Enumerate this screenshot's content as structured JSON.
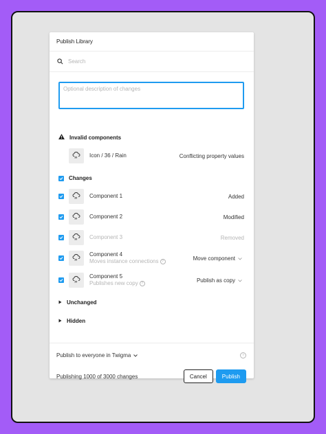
{
  "dialog": {
    "title": "Publish Library",
    "search_placeholder": "Search",
    "description_placeholder": "Optional description of changes"
  },
  "invalid": {
    "heading": "Invalid components",
    "item_name": "Icon / 36 / Rain",
    "item_status": "Conflicting property values"
  },
  "changes": {
    "heading": "Changes",
    "items": [
      {
        "name": "Component 1",
        "status": "Added"
      },
      {
        "name": "Component 2",
        "status": "Modified"
      },
      {
        "name": "Component 3",
        "status": "Removed"
      },
      {
        "name": "Component 4",
        "subtitle": "Moves instance connections",
        "action": "Move component"
      },
      {
        "name": "Component 5",
        "subtitle": "Publishes new copy",
        "action": "Publish as copy"
      }
    ]
  },
  "unchanged": {
    "heading": "Unchanged"
  },
  "hidden": {
    "heading": "Hidden"
  },
  "footer": {
    "publish_scope": "Publish to everyone in Twigma",
    "progress_text": "Publishing 1000 of 3000 changes",
    "cancel_label": "Cancel",
    "publish_label": "Publish"
  },
  "colors": {
    "accent": "#1e9bf0",
    "background": "#a35cf7"
  }
}
